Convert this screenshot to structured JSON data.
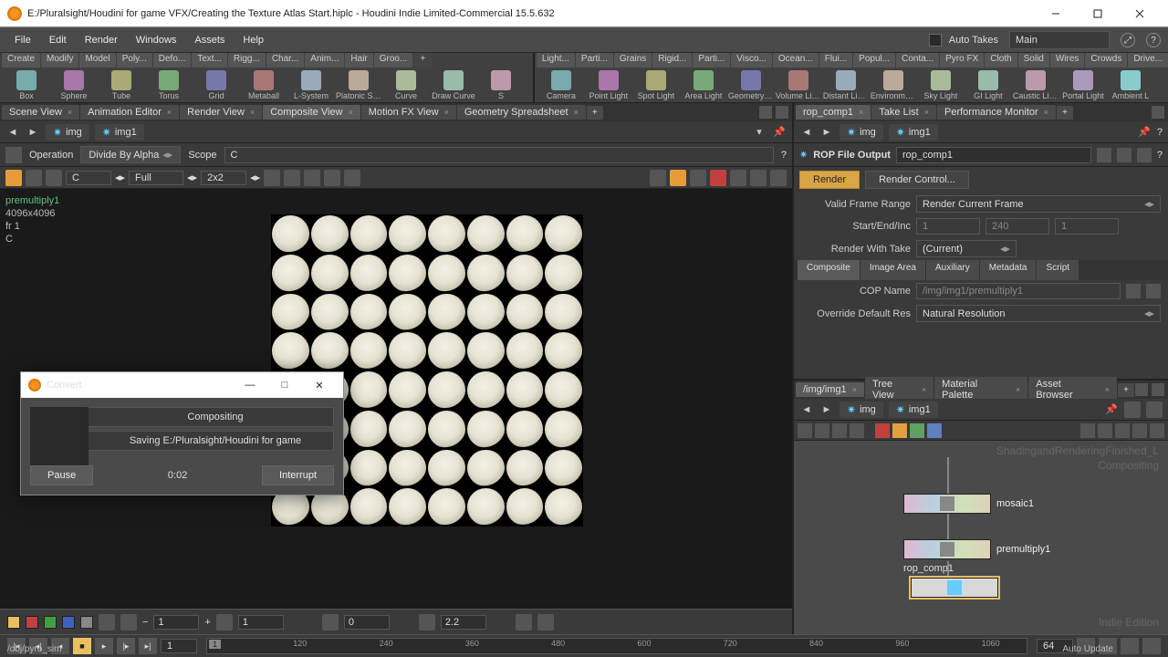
{
  "window": {
    "title": "E:/Pluralsight/Houdini for game VFX/Creating the Texture Atlas Start.hiplc - Houdini Indie Limited-Commercial 15.5.632"
  },
  "menubar": {
    "items": [
      "File",
      "Edit",
      "Render",
      "Windows",
      "Assets",
      "Help"
    ],
    "auto_takes": "Auto Takes",
    "main": "Main"
  },
  "shelf_left_tabs": [
    "Create",
    "Modify",
    "Model",
    "Poly...",
    "Defo...",
    "Text...",
    "Rigg...",
    "Char...",
    "Anim...",
    "Hair",
    "Groo..."
  ],
  "shelf_right_tabs": [
    "Light...",
    "Parti...",
    "Grains",
    "Rigid...",
    "Parti...",
    "Visco...",
    "Ocean...",
    "Flui...",
    "Popul...",
    "Conta...",
    "Pyro FX",
    "Cloth",
    "Solid",
    "Wires",
    "Crowds",
    "Drive..."
  ],
  "tools_left": [
    "Box",
    "Sphere",
    "Tube",
    "Torus",
    "Grid",
    "Metaball",
    "L-System",
    "Platonic Sol...",
    "Curve",
    "Draw Curve",
    "S"
  ],
  "tools_right": [
    "Camera",
    "Point Light",
    "Spot Light",
    "Area Light",
    "Geometry L...",
    "Volume Light",
    "Distant Light",
    "Environmen...",
    "Sky Light",
    "GI Light",
    "Caustic Light",
    "Portal Light",
    "Ambient L"
  ],
  "left_tabs": [
    "Scene View",
    "Animation Editor",
    "Render View",
    "Composite View",
    "Motion FX View",
    "Geometry Spreadsheet"
  ],
  "left_tab_selected": 3,
  "path_left": {
    "root": "img",
    "child": "img1"
  },
  "opbar": {
    "operation_label": "Operation",
    "operation_value": "Divide By Alpha",
    "scope_label": "Scope",
    "scope_value": "C"
  },
  "tb2": {
    "plane": "C",
    "view": "Full",
    "grid": "2x2"
  },
  "vp_info": {
    "node": "premultiply1",
    "res": "4096x4096",
    "frame": "fr 1",
    "plane": "C"
  },
  "footbar": {
    "frame": "1",
    "exposure": "1",
    "aspect": "0",
    "gamma": "2.2"
  },
  "convert": {
    "title": "Convert",
    "row1": "Compositing",
    "row2": "Saving E:/Pluralsight/Houdini for game",
    "pause": "Pause",
    "time": "0:02",
    "interrupt": "Interrupt"
  },
  "right_tabs_top": [
    "rop_comp1",
    "Take List",
    "Performance Monitor"
  ],
  "right_path": {
    "root": "img",
    "child": "img1"
  },
  "rop": {
    "type": "ROP File Output",
    "name": "rop_comp1",
    "render": "Render",
    "render_control": "Render Control...",
    "valid_frame_label": "Valid Frame Range",
    "valid_frame_value": "Render Current Frame",
    "startend_label": "Start/End/Inc",
    "start": "1",
    "end": "240",
    "inc": "1",
    "take_label": "Render With Take",
    "take_value": "(Current)",
    "subtabs": [
      "Composite",
      "Image Area",
      "Auxiliary",
      "Metadata",
      "Script"
    ],
    "copname_label": "COP Name",
    "copname_value": "/img/img1/premultiply1",
    "override_label": "Override Default Res",
    "override_value": "Natural Resolution"
  },
  "right_tabs_bottom": [
    "/img/img1",
    "Tree View",
    "Material Palette",
    "Asset Browser"
  ],
  "netview": {
    "watermark_top": "ShadingandRenderingFinished_L",
    "watermark_mid": "Compositing",
    "watermark_bot": "Indie Edition",
    "nodes": [
      {
        "name": "mosaic1"
      },
      {
        "name": "premultiply1"
      },
      {
        "name": "rop_comp1",
        "selected": true
      }
    ]
  },
  "statusbar": {
    "frame_start": "1",
    "tl_cursor": "1",
    "ticks": [
      "120",
      "240",
      "360",
      "480",
      "600",
      "720",
      "840",
      "960",
      "1060"
    ],
    "frame_end": "64",
    "path": "/obj/pyro_sim",
    "auto_update": "Auto Update"
  }
}
